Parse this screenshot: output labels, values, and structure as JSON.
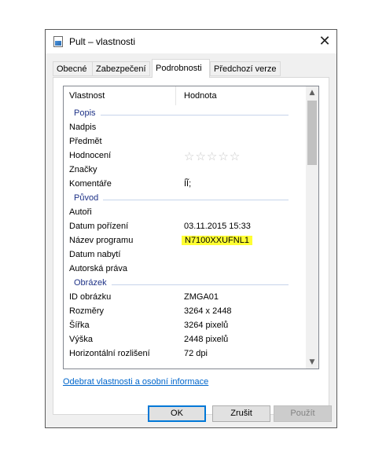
{
  "window": {
    "title": "Pult – vlastnosti",
    "close_glyph": "✕"
  },
  "tabs": [
    {
      "label": "Obecné"
    },
    {
      "label": "Zabezpečení"
    },
    {
      "label": "Podrobnosti",
      "active": true
    },
    {
      "label": "Předchozí verze"
    }
  ],
  "list": {
    "col_property": "Vlastnost",
    "col_value": "Hodnota",
    "groups": {
      "popis": {
        "label": "Popis",
        "rows": [
          {
            "name": "Nadpis",
            "value": ""
          },
          {
            "name": "Předmět",
            "value": ""
          },
          {
            "name": "Hodnocení",
            "value": "",
            "stars": 5
          },
          {
            "name": "Značky",
            "value": ""
          },
          {
            "name": "Komentáře",
            "value": "ÍĨ;"
          }
        ]
      },
      "puvod": {
        "label": "Původ",
        "rows": [
          {
            "name": "Autoři",
            "value": ""
          },
          {
            "name": "Datum pořízení",
            "value": "03.11.2015 15:33"
          },
          {
            "name": "Název programu",
            "value": "N7100XXUFNL1",
            "highlight": "#ffff33"
          },
          {
            "name": "Datum nabytí",
            "value": ""
          },
          {
            "name": "Autorská práva",
            "value": ""
          }
        ]
      },
      "obrazek": {
        "label": "Obrázek",
        "rows": [
          {
            "name": "ID obrázku",
            "value": "ZMGA01"
          },
          {
            "name": "Rozměry",
            "value": "3264 x 2448"
          },
          {
            "name": "Šířka",
            "value": "3264 pixelů"
          },
          {
            "name": "Výška",
            "value": "2448 pixelů"
          },
          {
            "name": "Horizontální rozlišení",
            "value": "72 dpi"
          }
        ]
      }
    }
  },
  "remove_link": "Odebrat vlastnosti a osobní informace",
  "buttons": {
    "ok": "OK",
    "cancel": "Zrušit",
    "apply": "Použít"
  },
  "colors": {
    "group_header": "#1e3287",
    "link": "#0066cc",
    "highlight": "#ffff33",
    "accent": "#0078d7"
  }
}
